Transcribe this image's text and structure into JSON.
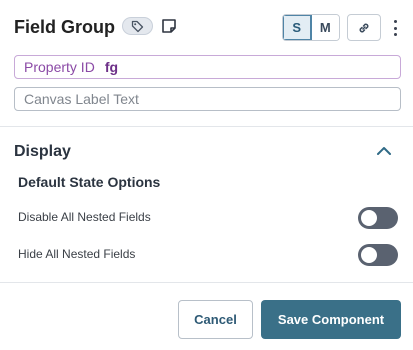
{
  "header": {
    "title": "Field Group",
    "tag_icon": "tag-icon",
    "note_icon": "note-icon",
    "sizes": [
      "S",
      "M"
    ],
    "active_size": "S",
    "link_icon": "link-icon",
    "more_icon": "kebab-menu-icon"
  },
  "property": {
    "label": "Property ID",
    "value": "fg"
  },
  "canvas_label": {
    "placeholder": "Canvas Label Text",
    "value": ""
  },
  "display": {
    "title": "Display",
    "collapse_icon": "chevron-up-icon",
    "subheading": "Default State Options",
    "options": [
      {
        "label": "Disable All Nested Fields",
        "enabled": false
      },
      {
        "label": "Hide All Nested Fields",
        "enabled": false
      }
    ]
  },
  "footer": {
    "cancel_label": "Cancel",
    "save_label": "Save Component"
  },
  "colors": {
    "accent": "#3a7088",
    "property_purple": "#8b4aa6",
    "toggle_off": "#5a6270"
  }
}
